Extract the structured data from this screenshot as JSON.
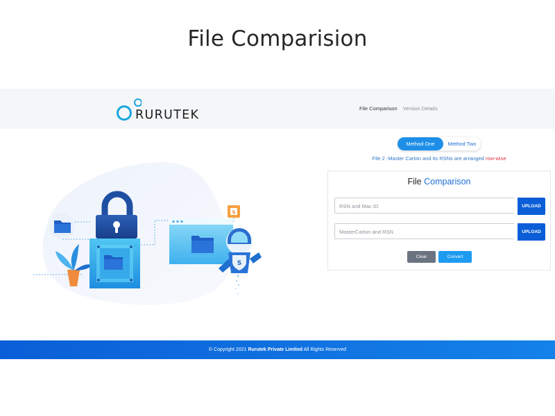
{
  "page_heading": "File Comparision",
  "brand": {
    "name": "RURUTEK"
  },
  "nav": {
    "items": [
      "File Comparison",
      "Version Details"
    ],
    "active": "File Comparison"
  },
  "method_toggle": {
    "options": [
      "Method One",
      "Method Two"
    ],
    "selected": "Method One"
  },
  "method_note": {
    "text": "File 2 -Master Carton and its RSNs are arranged ",
    "highlight": "row-wise"
  },
  "card": {
    "title_prefix": "File",
    "title_highlight": "Comparison",
    "inputs": [
      {
        "placeholder": "RSN and Mac ID",
        "button": "UPLOAD"
      },
      {
        "placeholder": "MasterCarton and RSN",
        "button": "UPLOAD"
      }
    ],
    "buttons": {
      "clear": "Clear",
      "convert": "Convert"
    }
  },
  "hero": {
    "badge_letter": "S",
    "shield_letter": "S"
  },
  "footer": {
    "prefix": "© Copyright 2021 ",
    "company": "Rurutek Private Limited",
    "suffix": " All Rights Reserved"
  },
  "colors": {
    "primary": "#0b5ed7",
    "accent": "#1d8fe8",
    "highlight": "#e0344a"
  }
}
